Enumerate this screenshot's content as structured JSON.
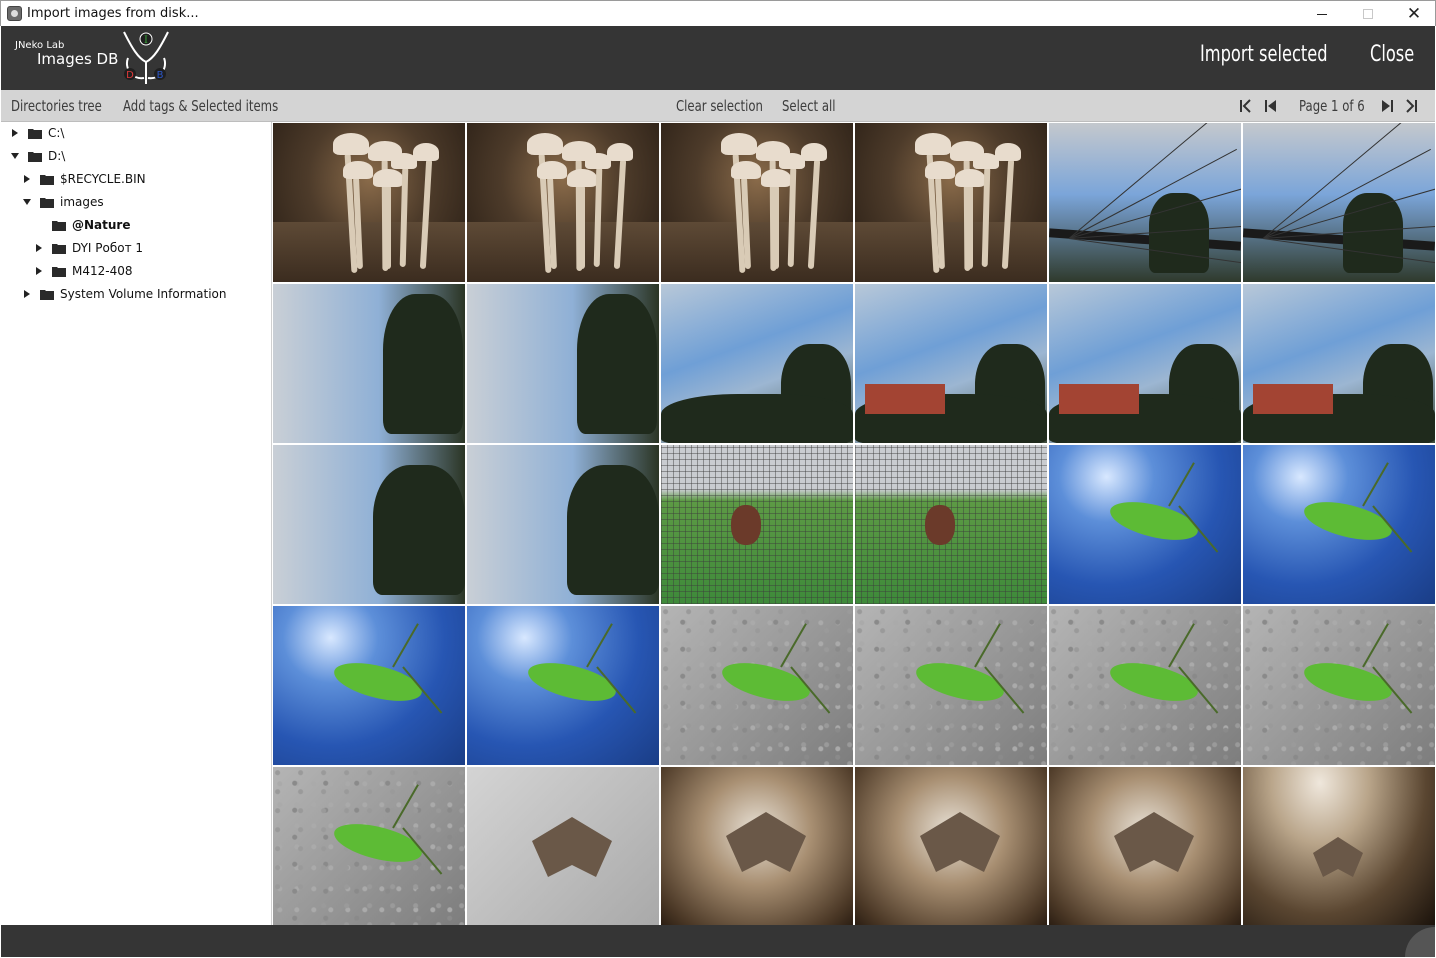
{
  "window": {
    "title": "Import images from disk...",
    "minimize_glyph": "",
    "maximize_glyph": "",
    "close_glyph": "✕"
  },
  "header": {
    "brand_small": "JNeko Lab",
    "brand_big": "Images DB",
    "logo_letters": [
      "I",
      "D",
      "B"
    ],
    "logo_colors": {
      "I": "#3aa63a",
      "D": "#e03a3a",
      "B": "#2b56c8"
    },
    "import_button": "Import selected",
    "close_button": "Close"
  },
  "toolbar": {
    "directories_tree": "Directories tree",
    "add_tags": "Add tags & Selected items",
    "clear_selection": "Clear selection",
    "select_all": "Select all",
    "page_label": "Page 1 of 6",
    "icons": [
      "first-page-icon",
      "prev-page-icon",
      "next-page-icon",
      "last-page-icon"
    ]
  },
  "tree": [
    {
      "label": "C:\\",
      "expanded": false
    },
    {
      "label": "D:\\",
      "expanded": true
    },
    {
      "label": "$RECYCLE.BIN",
      "expanded": false
    },
    {
      "label": "images",
      "expanded": true
    },
    {
      "label": "@Nature",
      "expanded": null,
      "selected": true
    },
    {
      "label": "DYI Робот 1",
      "expanded": false
    },
    {
      "label": "M412-408",
      "expanded": false
    },
    {
      "label": "System Volume Information",
      "expanded": false
    }
  ],
  "grid": {
    "columns": 6,
    "rows": 5,
    "thumbnails": [
      "mushrooms",
      "mushrooms",
      "mushrooms",
      "mushrooms",
      "street-sky-tilted",
      "street-sky-tilted",
      "sky-rainbow-tilted",
      "sky-rainbow-tilted",
      "sky-rainbow-street",
      "sky-rainbow-building",
      "sky-rainbow-building",
      "sky-rainbow-building",
      "sky-trees-tilted",
      "sky-road-tilted",
      "beetle-mesh",
      "beetle-mesh",
      "grasshopper-blue",
      "grasshopper-blue",
      "grasshopper-blue",
      "grasshopper-blue",
      "grasshopper-asphalt",
      "grasshopper-asphalt",
      "grasshopper-asphalt",
      "grasshopper-asphalt",
      "grasshopper-asphalt",
      "moth-grey",
      "moth-brown",
      "moth-brown",
      "moth-brown",
      "moth-dark"
    ]
  }
}
